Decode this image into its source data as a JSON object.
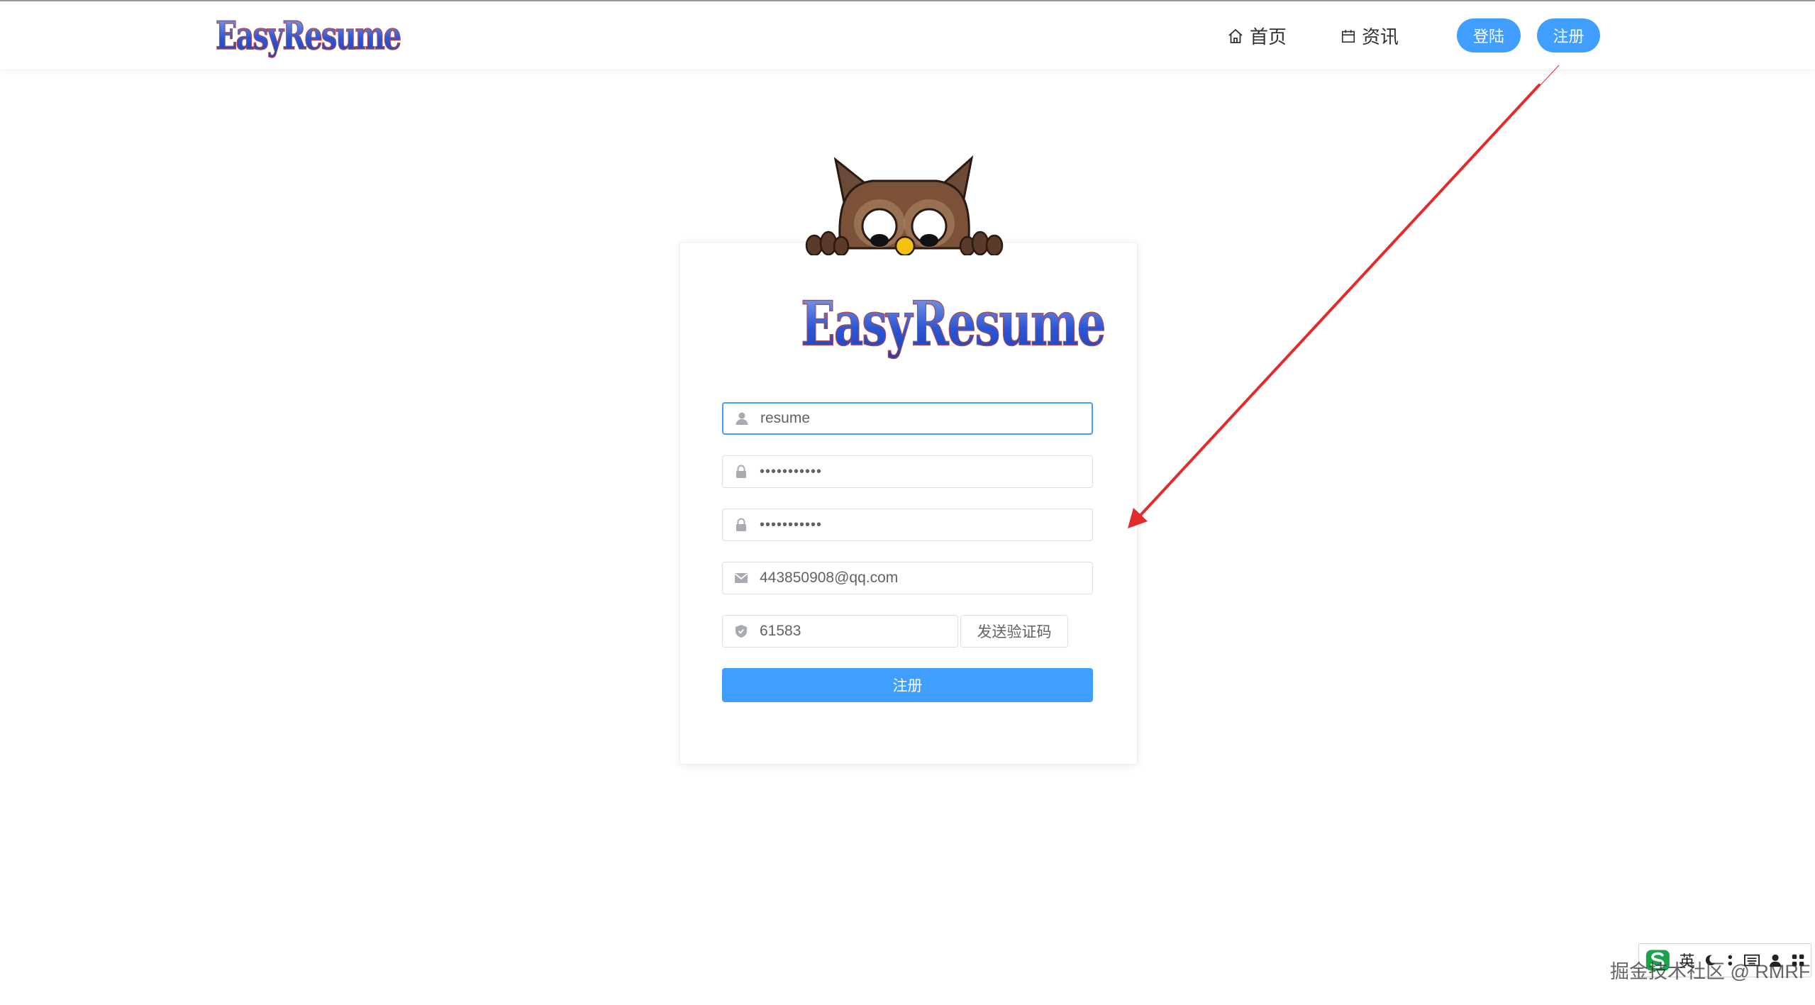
{
  "header": {
    "logo_text": "EasyResume",
    "nav": {
      "home_label": "首页",
      "news_label": "资讯"
    },
    "login_label": "登陆",
    "register_label": "注册"
  },
  "card": {
    "logo_text": "EasyResume",
    "form": {
      "username_value": "resume",
      "password_value": "•••••••••••",
      "confirm_password_value": "•••••••••••",
      "email_value": "443850908@qq.com",
      "code_value": "61583",
      "send_code_label": "发送验证码",
      "submit_label": "注册"
    }
  },
  "annotation": {
    "arrow_color": "#e32b2b"
  },
  "ime_toolbar": {
    "mode_label": "英"
  },
  "watermark": {
    "text": "掘金技术社区 @ RMRF"
  },
  "colors": {
    "primary": "#409eff",
    "border": "#dcdfe6",
    "text": "#606266"
  },
  "icons": [
    "home-icon",
    "calendar-icon",
    "user-icon",
    "lock-icon",
    "mail-icon",
    "shield-icon",
    "owl-mascot"
  ]
}
